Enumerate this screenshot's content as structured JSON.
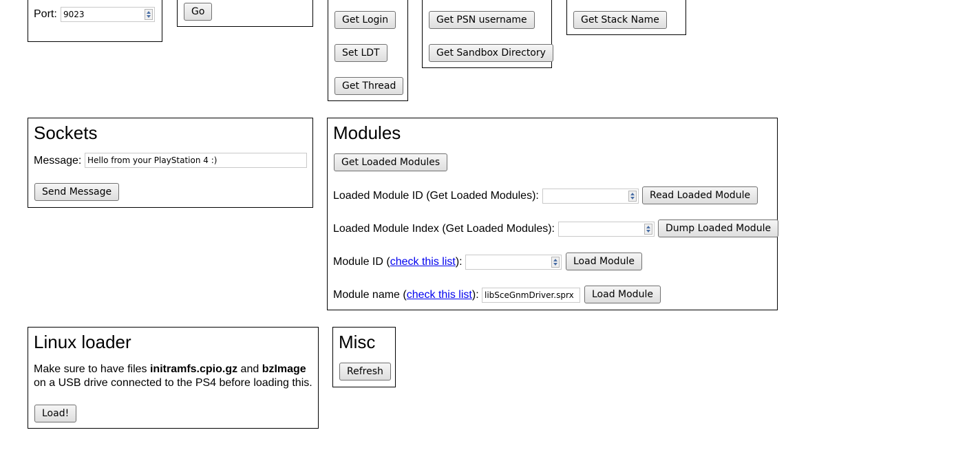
{
  "connection": {
    "port_label": "Port:",
    "port_value": "9023",
    "go_label": "Go"
  },
  "kernel": {
    "get_login": "Get Login",
    "set_ldt": "Set LDT",
    "get_thread": "Get Thread"
  },
  "user": {
    "get_psn_username": "Get PSN username",
    "get_sandbox_directory": "Get Sandbox Directory"
  },
  "stack": {
    "get_stack_name": "Get Stack Name"
  },
  "sockets": {
    "title": "Sockets",
    "message_label": "Message:",
    "message_value": "Hello from your PlayStation 4 :)",
    "send_label": "Send Message"
  },
  "modules": {
    "title": "Modules",
    "get_loaded_modules": "Get Loaded Modules",
    "loaded_id_label": "Loaded Module ID (Get Loaded Modules):",
    "loaded_id_value": "",
    "read_loaded_module": "Read Loaded Module",
    "loaded_index_label": "Loaded Module Index (Get Loaded Modules):",
    "loaded_index_value": "",
    "dump_loaded_module": "Dump Loaded Module",
    "module_id_prefix": "Module ID (",
    "module_id_link": "check this list",
    "module_id_suffix": "):",
    "module_id_value": "",
    "load_module_1": "Load Module",
    "module_name_prefix": "Module name (",
    "module_name_link": "check this list",
    "module_name_suffix": "):",
    "module_name_value": "libSceGnmDriver.sprx",
    "load_module_2": "Load Module"
  },
  "linux": {
    "title": "Linux loader",
    "text_1": "Make sure to have files ",
    "file_1": "initramfs.cpio.gz",
    "text_2": " and ",
    "file_2": "bzImage",
    "text_3": "on a USB drive connected to the PS4 before loading this.",
    "load_label": "Load!"
  },
  "misc": {
    "title": "Misc",
    "refresh_label": "Refresh"
  }
}
